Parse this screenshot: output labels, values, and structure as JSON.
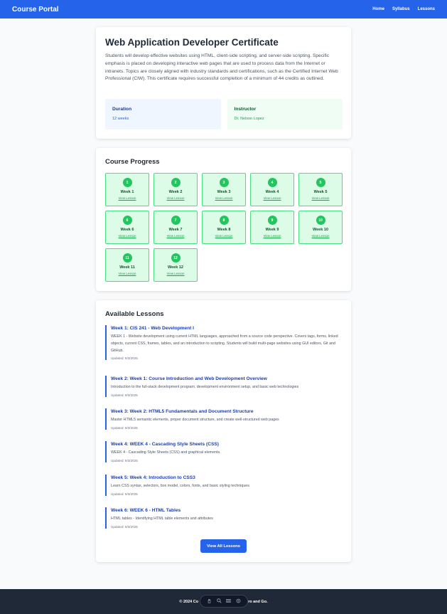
{
  "header": {
    "brand": "Course Portal",
    "nav": [
      "Home",
      "Syllabus",
      "Lessons"
    ]
  },
  "course": {
    "title": "Web Application Developer Certificate",
    "description": "Students will develop effective websites using HTML, client-side scripting, and server-side scripting. Specific emphasis is placed on developing interactive web pages that are used to process data from the Internet or intranets. Topics are closely aligned with industry standards and certifications, such as the Certified Internet Web Professional (CIW). This certificate requires successful completion of a minimum of 44 credits as outlined.",
    "duration_label": "Duration",
    "duration_value": "12 weeks",
    "instructor_label": "Instructor",
    "instructor_value": "Dr. Nelson Lopez"
  },
  "progress": {
    "title": "Course Progress",
    "link_label": "View Lesson",
    "weeks": [
      {
        "num": "1",
        "name": "Week 1"
      },
      {
        "num": "2",
        "name": "Week 2"
      },
      {
        "num": "3",
        "name": "Week 3"
      },
      {
        "num": "4",
        "name": "Week 4"
      },
      {
        "num": "5",
        "name": "Week 5"
      },
      {
        "num": "6",
        "name": "Week 6"
      },
      {
        "num": "7",
        "name": "Week 7"
      },
      {
        "num": "8",
        "name": "Week 8"
      },
      {
        "num": "9",
        "name": "Week 9"
      },
      {
        "num": "10",
        "name": "Week 10"
      },
      {
        "num": "11",
        "name": "Week 11"
      },
      {
        "num": "12",
        "name": "Week 12"
      }
    ]
  },
  "lessons": {
    "title": "Available Lessons",
    "items": [
      {
        "title": "Week 1: CIS 241 - Web Development I",
        "desc": "WEEK 1 - Website development using current HTML languages, approached from a source code perspective. Covers tags, forms, linked objects, current CSS, frames, tables, and an introduction to scripting. Students will build multi-page websites using GUI editors, Git and GitHub.",
        "date": "Updated: 9/3/2025"
      },
      {
        "title": "Week 2: Week 1: Course Introduction and Web Development Overview",
        "desc": "Introduction to the full-stack development program, development environment setup, and basic web technologies",
        "date": "Updated: 9/3/2025"
      },
      {
        "title": "Week 3: Week 2: HTML5 Fundamentals and Document Structure",
        "desc": "Master HTML5 semantic elements, proper document structure, and create well-structured web pages",
        "date": "Updated: 9/3/2025"
      },
      {
        "title": "Week 4: WEEK 4 - Cascading Style Sheets (CSS)",
        "desc": "WEEK 4 - Cascading Style Sheets (CSS) and graphical elements.",
        "date": "Updated: 9/3/2025"
      },
      {
        "title": "Week 5: Week 4: Introduction to CSS3",
        "desc": "Learn CSS syntax, selectors, box model, colors, fonts, and basic styling techniques",
        "date": "Updated: 9/3/2025"
      },
      {
        "title": "Week 6: WEEK 6 - HTML Tables",
        "desc": "HTML tables - Identifying HTML table elements and attributes",
        "date": "Updated: 9/3/2025"
      }
    ],
    "view_all_label": "View All Lessons"
  },
  "footer": {
    "text_left": "© 2024 Co",
    "text_right": "ro and Go."
  },
  "floating_toolbar": {
    "icons": [
      "hand-icon",
      "search-icon",
      "layers-icon",
      "settings-icon"
    ]
  }
}
